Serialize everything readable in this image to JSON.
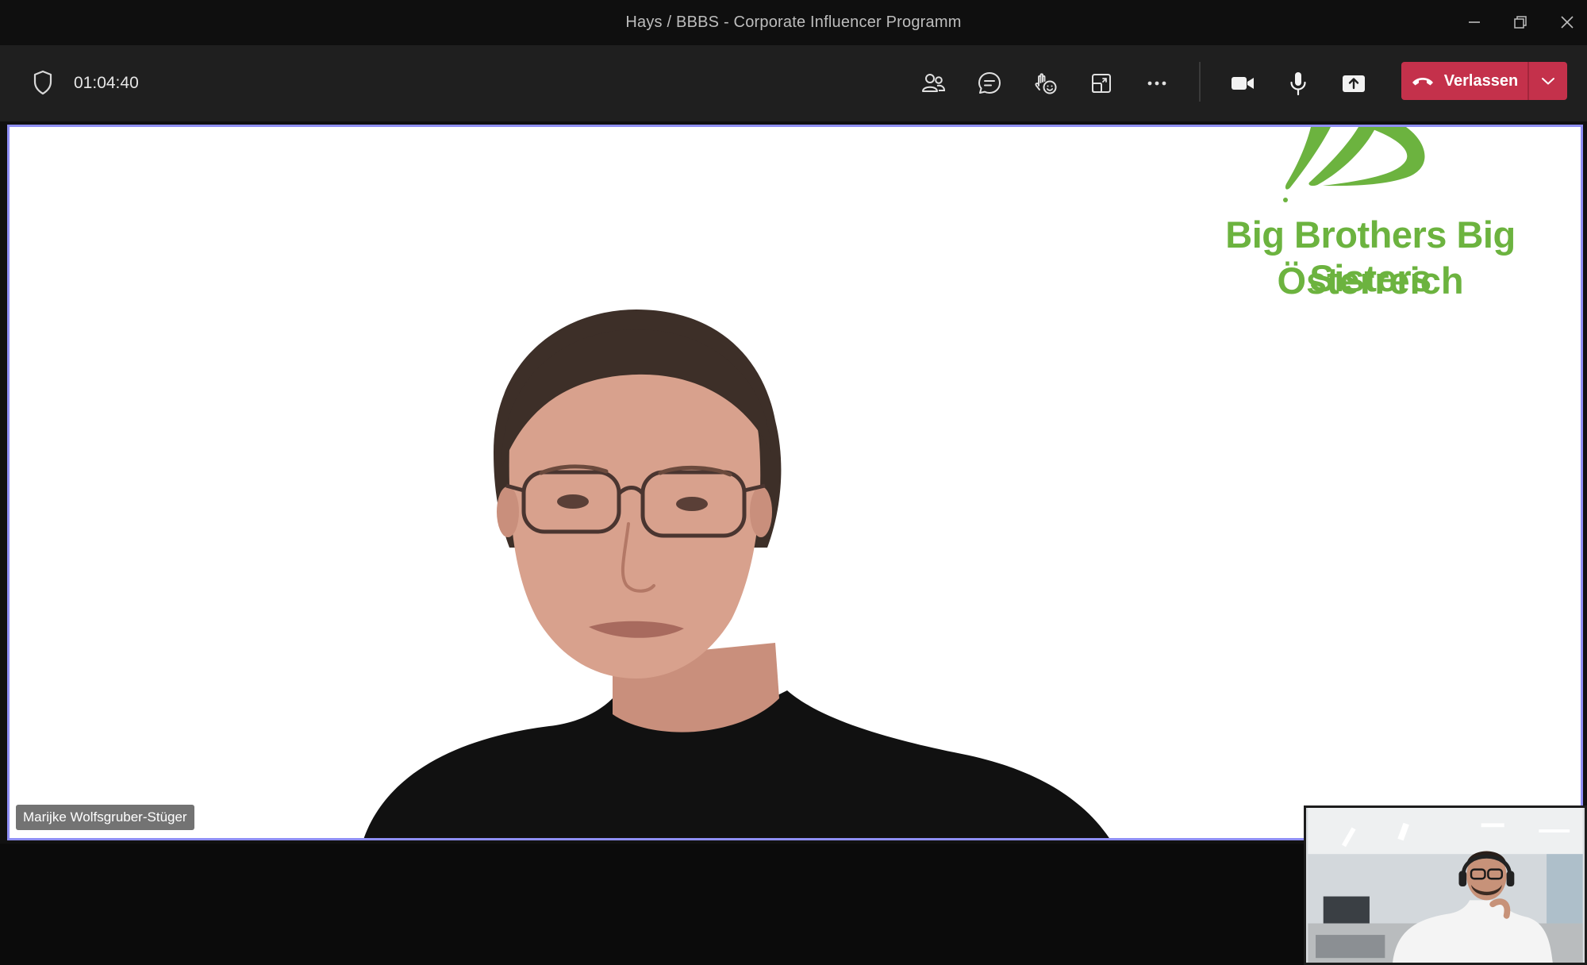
{
  "window": {
    "title": "Hays / BBBS - Corporate Influencer Programm",
    "controls": [
      "minimize-icon",
      "restore-icon",
      "close-icon"
    ]
  },
  "toolbar": {
    "timer": "01:04:40",
    "buttons": [
      "people-icon",
      "chat-icon",
      "reactions-icon",
      "rooms-icon",
      "more-icon",
      "camera-icon",
      "mic-icon",
      "share-icon"
    ],
    "leave_label": "Verlassen"
  },
  "stage": {
    "speaker_name": "Marijke Wolfsgruber-Stüger",
    "logo": {
      "line1": "Big Brothers Big Sisters",
      "line2": "Österreich",
      "color": "#6cb33f"
    },
    "frame_color": "#8f8ff5"
  },
  "colors": {
    "leave": "#c4314b",
    "toolbar": "#1f1f1f",
    "titlebar": "#0f0f0f"
  }
}
